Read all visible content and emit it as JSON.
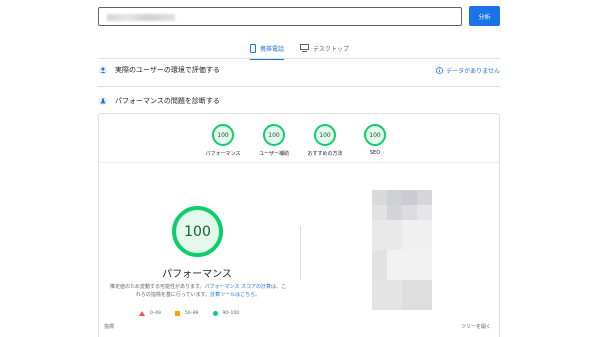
{
  "search": {
    "input_value": "",
    "analyze_label": "分析"
  },
  "tabs": {
    "mobile": "携帯電話",
    "desktop": "デスクトップ"
  },
  "field_data": {
    "title": "実際のユーザーの環境で評価する",
    "no_data": "データがありません"
  },
  "diagnose": {
    "title": "パフォーマンスの問題を診断する"
  },
  "gauges": [
    {
      "score": "100",
      "label": "パフォーマンス"
    },
    {
      "score": "100",
      "label": "ユーザー補助"
    },
    {
      "score": "100",
      "label": "おすすめの方法"
    },
    {
      "score": "100",
      "label": "SEO"
    }
  ],
  "main_score": {
    "score": "100",
    "title": "パフォーマンス"
  },
  "description": {
    "text1": "推定値のため変動する可能性があります。",
    "link1": "パフォーマンス スコアの計算",
    "text2": "は、これらの指標を基に行っています。",
    "link2": "計算ツールはこちら。"
  },
  "legend": {
    "fail": "0–49",
    "average": "50–89",
    "pass": "90–100"
  },
  "footer": {
    "metrics": "指標",
    "view_tree": "ツリーを開く"
  },
  "colors": {
    "accent": "#1a73e8",
    "pass": "#0cce6b",
    "average": "#ffa400",
    "fail": "#ff4e42"
  }
}
